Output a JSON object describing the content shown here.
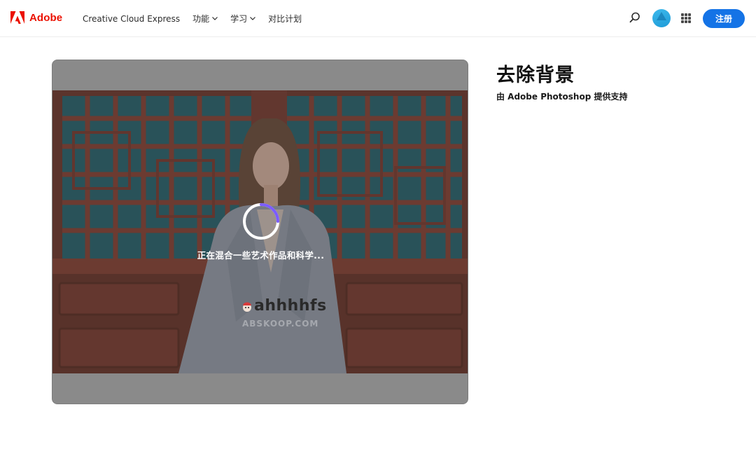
{
  "header": {
    "brand": "Adobe",
    "nav": [
      {
        "label": "Creative Cloud Express",
        "dropdown": false
      },
      {
        "label": "功能",
        "dropdown": true
      },
      {
        "label": "学习",
        "dropdown": true
      },
      {
        "label": "对比计划",
        "dropdown": false
      }
    ],
    "search_icon": "search-icon",
    "apps_icon": "apps-grid-icon",
    "signup_label": "注册"
  },
  "colors": {
    "brand_red": "#eb1000",
    "primary_blue": "#1473e6",
    "spinner_accent": "#7b5cff"
  },
  "editor": {
    "loading_text": "正在混合一些艺术作品和科学...",
    "watermark_text": "ahhhhfs",
    "watermark_sub": "ABSKOOP.COM"
  },
  "tool": {
    "title": "去除背景",
    "subtitle": "由 Adobe Photoshop 提供支持"
  }
}
